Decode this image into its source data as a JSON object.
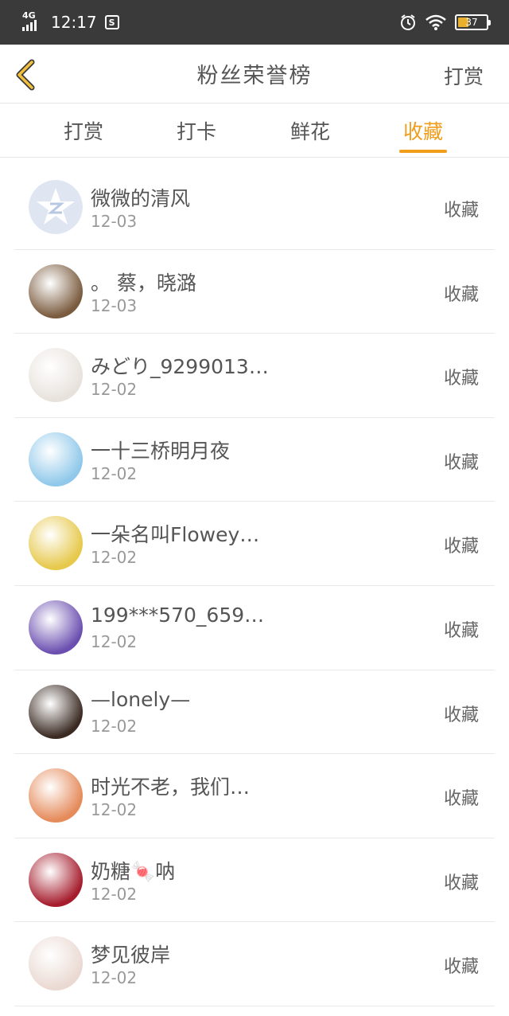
{
  "status_bar": {
    "network": "4G",
    "time": "12:17",
    "battery": "37",
    "battery_level": 0.37
  },
  "header": {
    "title": "粉丝荣誉榜",
    "action_label": "打赏"
  },
  "tabs": [
    {
      "label": "打赏",
      "active": false
    },
    {
      "label": "打卡",
      "active": false
    },
    {
      "label": "鲜花",
      "active": false
    },
    {
      "label": "收藏",
      "active": true
    }
  ],
  "fans": [
    {
      "name": "微微的清风",
      "date": "12-03",
      "action": "收藏",
      "avatar_color": "#dfe6f2"
    },
    {
      "name": "。 蔡，晓潞",
      "date": "12-03",
      "action": "收藏",
      "avatar_color": "#7a5b3e"
    },
    {
      "name": "みどり_9299013…",
      "date": "12-02",
      "action": "收藏",
      "avatar_color": "#e8e2dc"
    },
    {
      "name": "一十三桥明月夜",
      "date": "12-02",
      "action": "收藏",
      "avatar_color": "#8fc8ea"
    },
    {
      "name": "一朵名叫Flowey…",
      "date": "12-02",
      "action": "收藏",
      "avatar_color": "#e6c84a"
    },
    {
      "name": "199***570_659…",
      "date": "12-02",
      "action": "收藏",
      "avatar_color": "#6b4fb0"
    },
    {
      "name": "—lonely—",
      "date": "12-02",
      "action": "收藏",
      "avatar_color": "#3a2a22"
    },
    {
      "name": "时光不老，我们…",
      "date": "12-02",
      "action": "收藏",
      "avatar_color": "#e58a5a"
    },
    {
      "name": "奶糖🍬呐",
      "date": "12-02",
      "action": "收藏",
      "avatar_color": "#a51c2c"
    },
    {
      "name": "梦见彼岸",
      "date": "12-02",
      "action": "收藏",
      "avatar_color": "#ead9d2"
    }
  ],
  "colors": {
    "accent": "#ef9d1b",
    "status_bar": "#3a3a3a",
    "text": "#555555",
    "muted": "#999999"
  }
}
